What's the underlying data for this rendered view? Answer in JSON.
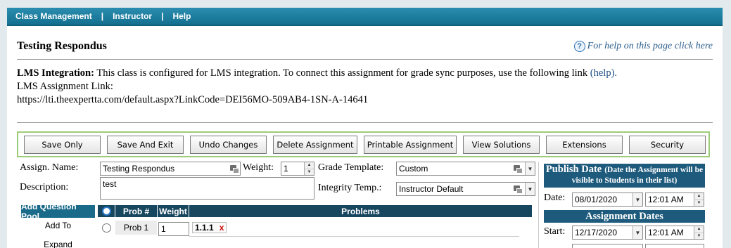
{
  "nav": {
    "items": [
      "Class Management",
      "Instructor",
      "Help"
    ],
    "separator": "|"
  },
  "page_title": "Testing Respondus",
  "help_link": "For help on this page click here",
  "lms": {
    "heading": "LMS Integration:",
    "text": "This class is configured for LMS integration. To connect this assignment for grade sync purposes, use the following link",
    "help": "(help).",
    "link_label": "LMS Assignment Link:",
    "link_url": "https://lti.theexpertta.com/default.aspx?LinkCode=DEI56MO-509AB4-1SN-A-14641"
  },
  "buttons": [
    "Save Only",
    "Save And Exit",
    "Undo Changes",
    "Delete Assignment",
    "Printable Assignment",
    "View Solutions",
    "Extensions",
    "Security"
  ],
  "form": {
    "name_label": "Assign. Name:",
    "name_value": "Testing Respondus",
    "weight_label": "Weight:",
    "weight_value": "1",
    "grade_template_label": "Grade Template:",
    "grade_template_value": "Custom",
    "description_label": "Description:",
    "description_value": "test",
    "integrity_label": "Integrity Temp.:",
    "integrity_value": "Instructor Default"
  },
  "sidebar": {
    "pool_button": "Add Question Pool",
    "add_to": "Add To",
    "expand": "Expand"
  },
  "problems": {
    "headers": {
      "num": "Prob #",
      "weight": "Weight",
      "problems": "Problems"
    },
    "rows": [
      {
        "num": "Prob 1",
        "weight": "1",
        "problem": "1.1.1",
        "remove": "x"
      }
    ]
  },
  "publish": {
    "title": "Publish Date",
    "note": "(Date the Assignment will be visible to Students in their list)",
    "date_label": "Date:",
    "date_value": "08/01/2020",
    "time_value": "12:01 AM"
  },
  "assignment_dates": {
    "title": "Assignment Dates",
    "start_label": "Start:",
    "start_date": "12/17/2020",
    "start_time": "12:01 AM"
  },
  "colors": {
    "nav": "#1a7fa3",
    "header": "#17465f",
    "panel": "#1d5a7c",
    "button_bar_border": "#9ccc7a",
    "remove": "#d01010"
  }
}
